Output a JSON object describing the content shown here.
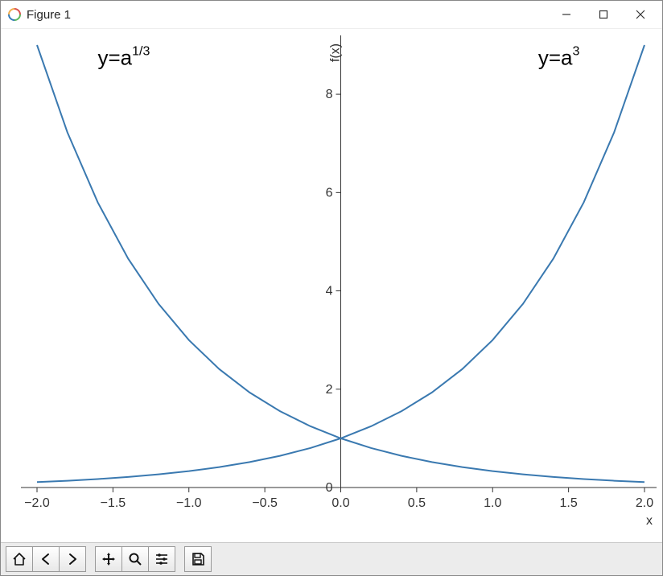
{
  "window": {
    "title": "Figure 1"
  },
  "toolbar": {
    "home": "Home",
    "back": "Back",
    "forward": "Forward",
    "pan": "Pan",
    "zoom": "Zoom",
    "configure": "Configure subplots",
    "save": "Save"
  },
  "chart_data": {
    "type": "line",
    "xlabel": "x",
    "ylabel": "f(x)",
    "xlim": [
      -2.0,
      2.0
    ],
    "ylim": [
      0,
      9
    ],
    "xticks": [
      -2.0,
      -1.5,
      -1.0,
      -0.5,
      0.0,
      0.5,
      1.0,
      1.5,
      2.0
    ],
    "xtick_labels": [
      "−2.0",
      "−1.5",
      "−1.0",
      "−0.5",
      "0.0",
      "0.5",
      "1.0",
      "1.5",
      "2.0"
    ],
    "yticks": [
      0,
      2,
      4,
      6,
      8
    ],
    "ytick_labels": [
      "0",
      "2",
      "4",
      "6",
      "8"
    ],
    "annotations": [
      {
        "text_html": "y=a<sup>1/3</sup>",
        "base": "y=a",
        "sup": "1/3",
        "x": -1.6,
        "y": 8.6
      },
      {
        "text_html": "y=a<sup>3</sup>",
        "base": "y=a",
        "sup": "3",
        "x": 1.3,
        "y": 8.6
      }
    ],
    "series": [
      {
        "name": "y=a^(1/3)",
        "x": [
          -2.0,
          -1.8,
          -1.6,
          -1.4,
          -1.2,
          -1.0,
          -0.8,
          -0.6,
          -0.4,
          -0.2,
          0.0,
          0.2,
          0.4,
          0.6,
          0.8,
          1.0,
          1.2,
          1.4,
          1.6,
          1.8,
          2.0
        ],
        "y": [
          9.0,
          7.225,
          5.8,
          4.656,
          3.737,
          3.0,
          2.408,
          1.933,
          1.552,
          1.246,
          1.0,
          0.803,
          0.644,
          0.517,
          0.415,
          0.333,
          0.268,
          0.215,
          0.172,
          0.138,
          0.111
        ]
      },
      {
        "name": "y=a^3",
        "x": [
          -2.0,
          -1.8,
          -1.6,
          -1.4,
          -1.2,
          -1.0,
          -0.8,
          -0.6,
          -0.4,
          -0.2,
          0.0,
          0.2,
          0.4,
          0.6,
          0.8,
          1.0,
          1.2,
          1.4,
          1.6,
          1.8,
          2.0
        ],
        "y": [
          0.111,
          0.138,
          0.172,
          0.215,
          0.268,
          0.333,
          0.415,
          0.517,
          0.644,
          0.803,
          1.0,
          1.246,
          1.552,
          1.933,
          2.408,
          3.0,
          3.737,
          4.656,
          5.8,
          7.225,
          9.0
        ]
      }
    ]
  }
}
